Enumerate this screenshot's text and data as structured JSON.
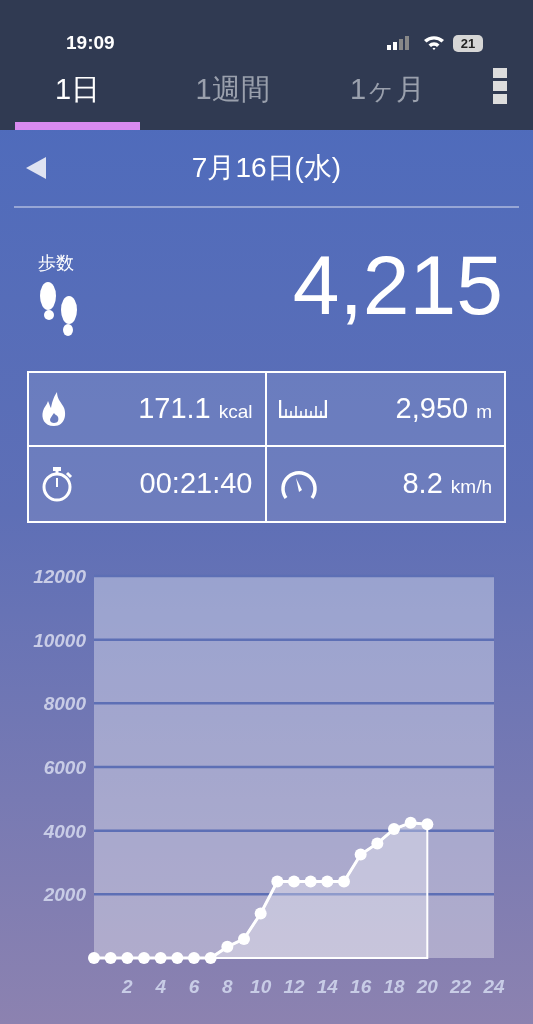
{
  "status_bar": {
    "time": "19:09",
    "battery": "21"
  },
  "tabs": [
    {
      "label": "1日",
      "selected": true
    },
    {
      "label": "1週間",
      "selected": false
    },
    {
      "label": "1ヶ月",
      "selected": false
    }
  ],
  "date": "7月16日(水)",
  "steps": {
    "label": "歩数",
    "value": "4,215"
  },
  "stats": [
    {
      "kind": "calories",
      "value": "171.1",
      "unit": "kcal"
    },
    {
      "kind": "distance",
      "value": "2,950",
      "unit": "m"
    },
    {
      "kind": "duration",
      "value": "00:21:40"
    },
    {
      "kind": "speed",
      "value": "8.2",
      "unit": "km/h"
    }
  ],
  "chart_data": {
    "type": "area",
    "x": [
      0,
      1,
      2,
      3,
      4,
      5,
      6,
      7,
      8,
      9,
      10,
      11,
      12,
      13,
      14,
      15,
      16,
      17,
      18,
      19,
      20
    ],
    "series": [
      {
        "color": "#ffffff",
        "values": [
          0,
          0,
          0,
          0,
          0,
          0,
          0,
          0,
          350,
          600,
          1400,
          2400,
          2400,
          2400,
          2400,
          2400,
          3250,
          3600,
          4050,
          4250,
          4200
        ]
      }
    ],
    "grid": true,
    "xlim": [
      0,
      24
    ],
    "ylim": [
      0,
      12000
    ],
    "xticks": [
      2,
      4,
      6,
      8,
      10,
      12,
      14,
      16,
      18,
      20,
      22,
      24
    ],
    "yticks": [
      2000,
      4000,
      6000,
      8000,
      10000,
      12000
    ]
  }
}
